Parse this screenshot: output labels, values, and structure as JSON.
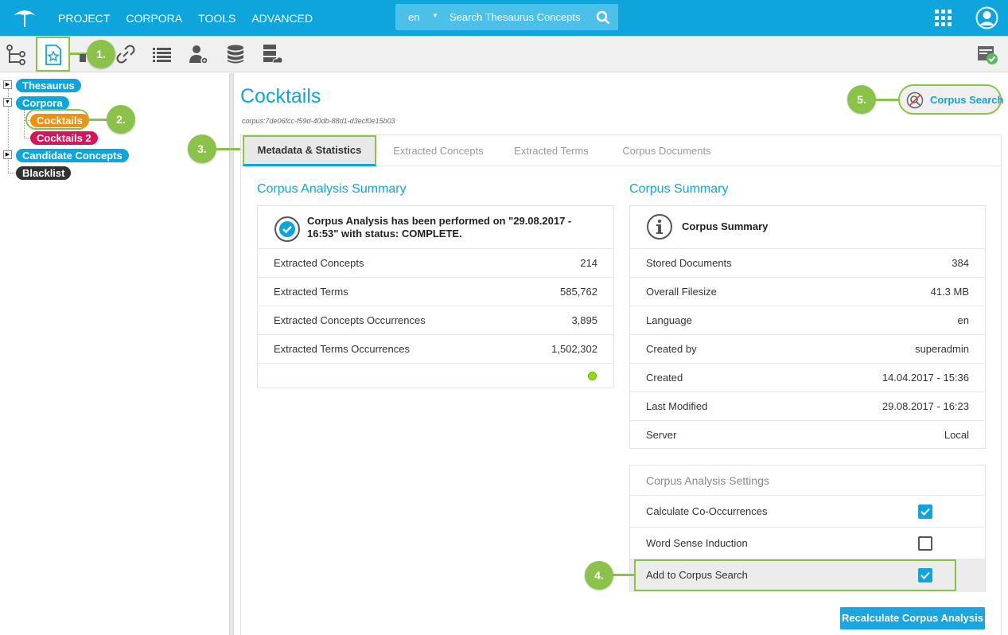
{
  "topbar": {
    "nav": [
      "PROJECT",
      "CORPORA",
      "TOOLS",
      "ADVANCED"
    ],
    "lang": "en",
    "search_placeholder": "Search Thesaurus Concepts"
  },
  "callouts": {
    "c1": "1.",
    "c2": "2.",
    "c3": "3.",
    "c4": "4.",
    "c5": "5."
  },
  "tree": {
    "thesaurus": "Thesaurus",
    "corpora": "Corpora",
    "cocktails": "Cocktails",
    "cocktails2": "Cocktails 2",
    "candidate": "Candidate Concepts",
    "blacklist": "Blacklist"
  },
  "page": {
    "title": "Cocktails",
    "corpus_id": "corpus:7de06fcc-f59d-40db-88d1-d3ecf0e15b03",
    "corpus_search": "Corpus Search"
  },
  "tabs": [
    "Metadata & Statistics",
    "Extracted Concepts",
    "Extracted Terms",
    "Corpus Documents"
  ],
  "analysis": {
    "title": "Corpus Analysis Summary",
    "message": "Corpus Analysis has been performed on \"29.08.2017 - 16:53\" with status: COMPLETE.",
    "rows": [
      {
        "k": "Extracted Concepts",
        "v": "214"
      },
      {
        "k": "Extracted Terms",
        "v": "585,762"
      },
      {
        "k": "Extracted Concepts Occurrences",
        "v": "3,895"
      },
      {
        "k": "Extracted Terms Occurrences",
        "v": "1,502,302"
      }
    ]
  },
  "summary": {
    "title": "Corpus Summary",
    "header": "Corpus Summary",
    "rows": [
      {
        "k": "Stored Documents",
        "v": "384"
      },
      {
        "k": "Overall Filesize",
        "v": "41.3 MB"
      },
      {
        "k": "Language",
        "v": "en"
      },
      {
        "k": "Created by",
        "v": "superadmin"
      },
      {
        "k": "Created",
        "v": "14.04.2017 - 15:36"
      },
      {
        "k": "Last Modified",
        "v": "29.08.2017 - 16:23"
      },
      {
        "k": "Server",
        "v": "Local"
      }
    ]
  },
  "settings": {
    "title": "Corpus Analysis Settings",
    "items": [
      {
        "label": "Calculate Co-Occurrences",
        "checked": true
      },
      {
        "label": "Word Sense Induction",
        "checked": false
      },
      {
        "label": "Add to Corpus Search",
        "checked": true
      }
    ],
    "recalc": "Recalculate Corpus Analysis"
  },
  "colors": {
    "brand": "#0ea5dd",
    "callout": "#8bc34a"
  }
}
